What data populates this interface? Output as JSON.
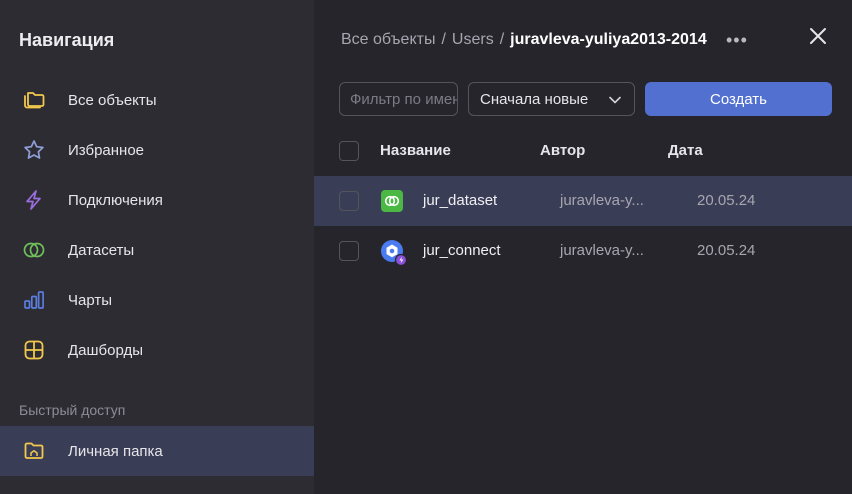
{
  "sidebar": {
    "title": "Навигация",
    "items": [
      {
        "label": "Все объекты",
        "icon": "folders-icon"
      },
      {
        "label": "Избранное",
        "icon": "star-icon"
      },
      {
        "label": "Подключения",
        "icon": "lightning-icon"
      },
      {
        "label": "Датасеты",
        "icon": "dataset-rings-icon"
      },
      {
        "label": "Чарты",
        "icon": "chart-bars-icon"
      },
      {
        "label": "Дашборды",
        "icon": "dashboard-grid-icon"
      }
    ],
    "quick_access_label": "Быстрый доступ",
    "personal_folder": {
      "label": "Личная папка",
      "icon": "home-folder-icon"
    }
  },
  "breadcrumb": {
    "root": "Все объекты",
    "sep1": "/",
    "middle": "Users",
    "sep2": "/",
    "current": "juravleva-yuliya2013-2014",
    "more": "•••"
  },
  "toolbar": {
    "filter_placeholder": "Фильтр по имени",
    "sort_value": "Сначала новые",
    "create_label": "Создать"
  },
  "table": {
    "headers": {
      "name": "Название",
      "author": "Автор",
      "date": "Дата"
    },
    "rows": [
      {
        "name": "jur_dataset",
        "author": "juravleva-y...",
        "date": "20.05.24",
        "icon": "dataset-icon"
      },
      {
        "name": "jur_connect",
        "author": "juravleva-y...",
        "date": "20.05.24",
        "icon": "connection-icon"
      }
    ]
  },
  "colors": {
    "accent": "#5270d0",
    "active_row": "#3a3d56",
    "sidebar_bg": "#2d2c33",
    "main_bg": "#26252b"
  }
}
